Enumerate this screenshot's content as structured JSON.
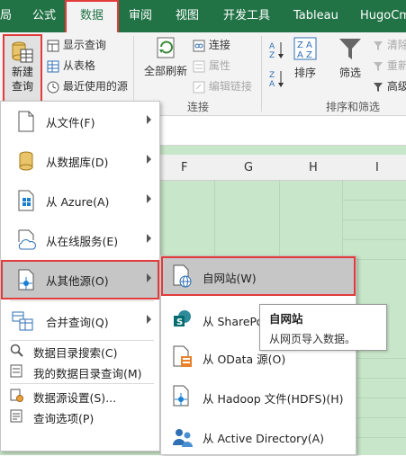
{
  "tabs": [
    {
      "label": "局"
    },
    {
      "label": "公式"
    },
    {
      "label": "数据"
    },
    {
      "label": "审阅"
    },
    {
      "label": "视图"
    },
    {
      "label": "开发工具"
    },
    {
      "label": "Tableau"
    },
    {
      "label": "HugoCm"
    }
  ],
  "ribbon": {
    "new_query_line1": "新建",
    "new_query_line2": "查询",
    "show_query": "显示查询",
    "from_table": "从表格",
    "recent_sources": "最近使用的源",
    "refresh_all_line1": "全部刷新",
    "connections": "连接",
    "properties": "属性",
    "edit_links": "编辑链接",
    "group_connections": "连接",
    "sort": "排序",
    "filter": "筛选",
    "clear": "清除",
    "reapply": "重新",
    "advanced": "高级",
    "group_sort_filter": "排序和筛选"
  },
  "columns": [
    "F",
    "G",
    "H",
    "I"
  ],
  "menu": {
    "items": [
      {
        "label": "从文件(F)"
      },
      {
        "label": "从数据库(D)"
      },
      {
        "label": "从 Azure(A)"
      },
      {
        "label": "从在线服务(E)"
      },
      {
        "label": "从其他源(O)"
      },
      {
        "label": "合并查询(Q)"
      }
    ],
    "small_items": [
      {
        "label": "数据目录搜索(C)"
      },
      {
        "label": "我的数据目录查询(M)"
      },
      {
        "label": "数据源设置(S)..."
      },
      {
        "label": "查询选项(P)"
      }
    ]
  },
  "submenu": {
    "items": [
      {
        "label": "自网站(W)"
      },
      {
        "label": "从 SharePo"
      },
      {
        "label": "从 OData 源(O)"
      },
      {
        "label": "从 Hadoop 文件(HDFS)(H)"
      },
      {
        "label": "从 Active Directory(A)"
      }
    ]
  },
  "tooltip": {
    "title": "自网站",
    "description": "从网页导入数据。"
  },
  "colors": {
    "excel_green": "#217346",
    "highlight_red": "#e23b3b",
    "sheet_green": "#c8e6c9"
  }
}
